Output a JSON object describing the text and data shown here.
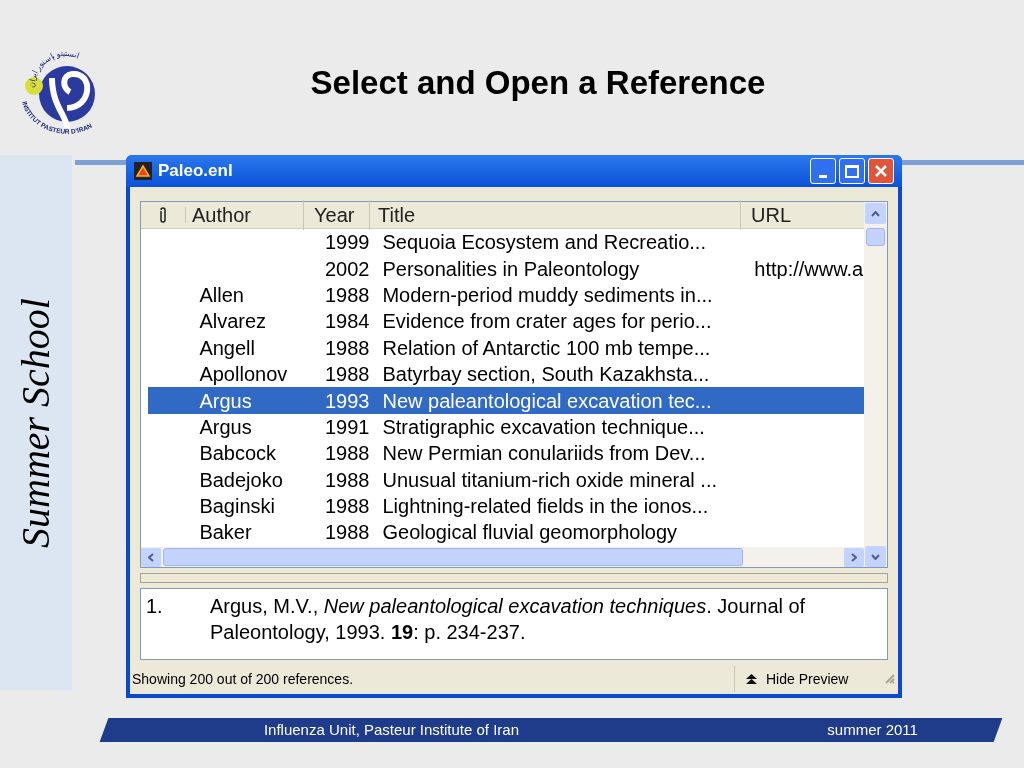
{
  "slide": {
    "title": "Select and Open a Reference",
    "logo": {
      "arabic": "انستیتو پاستور ایران",
      "latin": "INSTITUT PASTEUR D'IRAN"
    },
    "side_text": "Summer School"
  },
  "window": {
    "title": "Paleo.enl",
    "columns": [
      "Author",
      "Year",
      "Title",
      "URL"
    ],
    "rows": [
      {
        "author": "",
        "year": "1999",
        "title": "Sequoia Ecosystem and Recreatio...",
        "url": "",
        "selected": false
      },
      {
        "author": "",
        "year": "2002",
        "title": "Personalities in Paleontology",
        "url": "http://www.a",
        "selected": false
      },
      {
        "author": "Allen",
        "year": "1988",
        "title": "Modern-period muddy sediments in...",
        "url": "",
        "selected": false
      },
      {
        "author": "Alvarez",
        "year": "1984",
        "title": "Evidence from crater ages for perio...",
        "url": "",
        "selected": false
      },
      {
        "author": "Angell",
        "year": "1988",
        "title": "Relation of Antarctic 100 mb tempe...",
        "url": "",
        "selected": false
      },
      {
        "author": "Apollonov",
        "year": "1988",
        "title": "Batyrbay section, South Kazakhsta...",
        "url": "",
        "selected": false
      },
      {
        "author": "Argus",
        "year": "1993",
        "title": "New paleantological excavation tec...",
        "url": "",
        "selected": true
      },
      {
        "author": "Argus",
        "year": "1991",
        "title": "Stratigraphic excavation technique...",
        "url": "",
        "selected": false
      },
      {
        "author": "Babcock",
        "year": "1988",
        "title": "New Permian conulariids from Dev...",
        "url": "",
        "selected": false
      },
      {
        "author": "Badejoko",
        "year": "1988",
        "title": "Unusual titanium-rich oxide mineral ...",
        "url": "",
        "selected": false
      },
      {
        "author": "Baginski",
        "year": "1988",
        "title": "Lightning-related fields in the ionos...",
        "url": "",
        "selected": false
      },
      {
        "author": "Baker",
        "year": "1988",
        "title": "Geological fluvial geomorphology",
        "url": "",
        "selected": false
      }
    ],
    "preview": {
      "number": "1.",
      "text": "Argus, M.V., *New paleantological excavation techniques*. Journal of Paleontology, 1993. **19**: p. 234-237."
    },
    "status_bar": {
      "text": "Showing 200 out of 200 references.",
      "button": "Hide Preview"
    }
  },
  "footer": {
    "left": "Influenza Unit, Pasteur Institute of Iran",
    "right": "summer 2011"
  }
}
